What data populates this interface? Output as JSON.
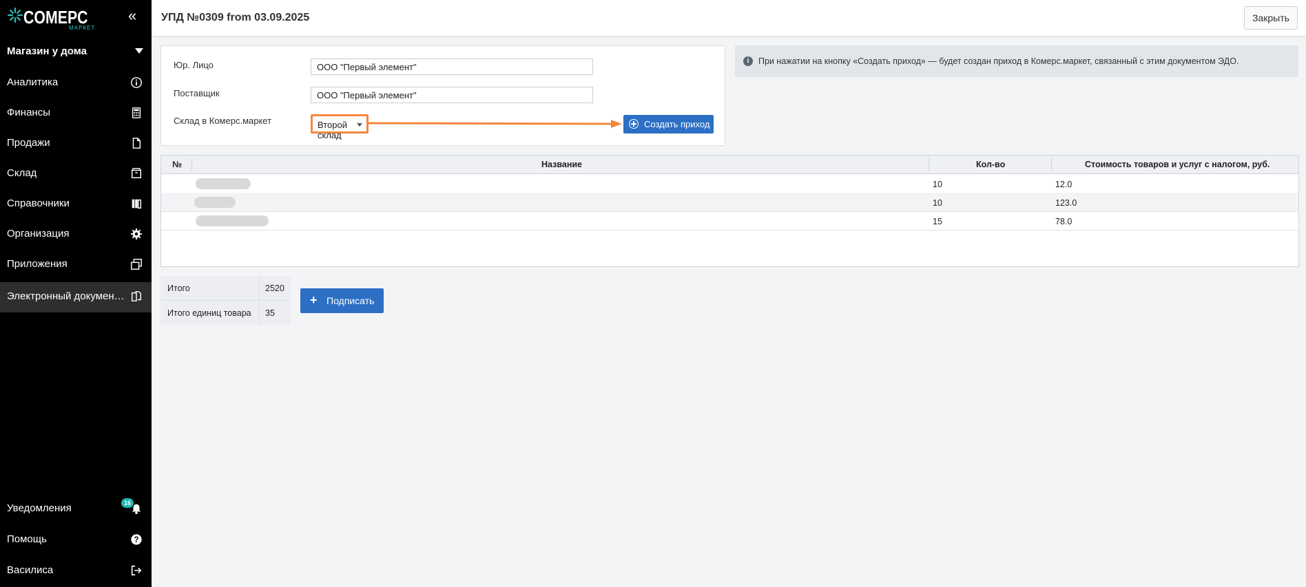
{
  "brand": {
    "name": "COMEPC",
    "subtitle": "МАРКЕТ",
    "accent": "#1fb5b0"
  },
  "sidebar": {
    "store": "Магазин у дома",
    "items": [
      {
        "label": "Аналитика",
        "icon": "info-circle-icon"
      },
      {
        "label": "Финансы",
        "icon": "calculator-icon"
      },
      {
        "label": "Продажи",
        "icon": "document-icon"
      },
      {
        "label": "Склад",
        "icon": "box-icon"
      },
      {
        "label": "Справочники",
        "icon": "books-icon"
      },
      {
        "label": "Организация",
        "icon": "gear-icon"
      },
      {
        "label": "Приложения",
        "icon": "windows-icon"
      },
      {
        "label": "Электронный документо...",
        "icon": "documents-icon",
        "active": true
      }
    ],
    "bottom": [
      {
        "label": "Уведомления",
        "icon": "bell-icon",
        "badge": "16"
      },
      {
        "label": "Помощь",
        "icon": "help-icon"
      },
      {
        "label": "Василиса",
        "icon": "logout-icon"
      }
    ]
  },
  "header": {
    "title": "УПД №0309 from 03.09.2025",
    "close_label": "Закрыть"
  },
  "form": {
    "legal_entity_label": "Юр. Лицо",
    "legal_entity_value": "ООО \"Первый элемент\"",
    "supplier_label": "Поставщик",
    "supplier_value": "ООО \"Первый элемент\"",
    "warehouse_label": "Склад в Комерс.маркет",
    "warehouse_value": "Второй склад",
    "create_receipt_label": "Создать приход"
  },
  "info": {
    "text": "При нажатии на кнопку «Создать приход» — будет создан приход в Комерс.маркет, связанный с этим документом ЭДО."
  },
  "table": {
    "columns": [
      "№",
      "Название",
      "Кол-во",
      "Стоимость товаров и услуг с налогом, руб."
    ],
    "rows": [
      {
        "qty": "10",
        "cost": "12.0"
      },
      {
        "qty": "10",
        "cost": "123.0"
      },
      {
        "qty": "15",
        "cost": "78.0"
      }
    ]
  },
  "totals": {
    "total_label": "Итого",
    "total_value": "2520",
    "units_label": "Итого единиц товара",
    "units_value": "35"
  },
  "sign_label": "Подписать",
  "colors": {
    "primary": "#2c6fc4",
    "highlight": "#f4873f",
    "sidebar": "#000000"
  }
}
